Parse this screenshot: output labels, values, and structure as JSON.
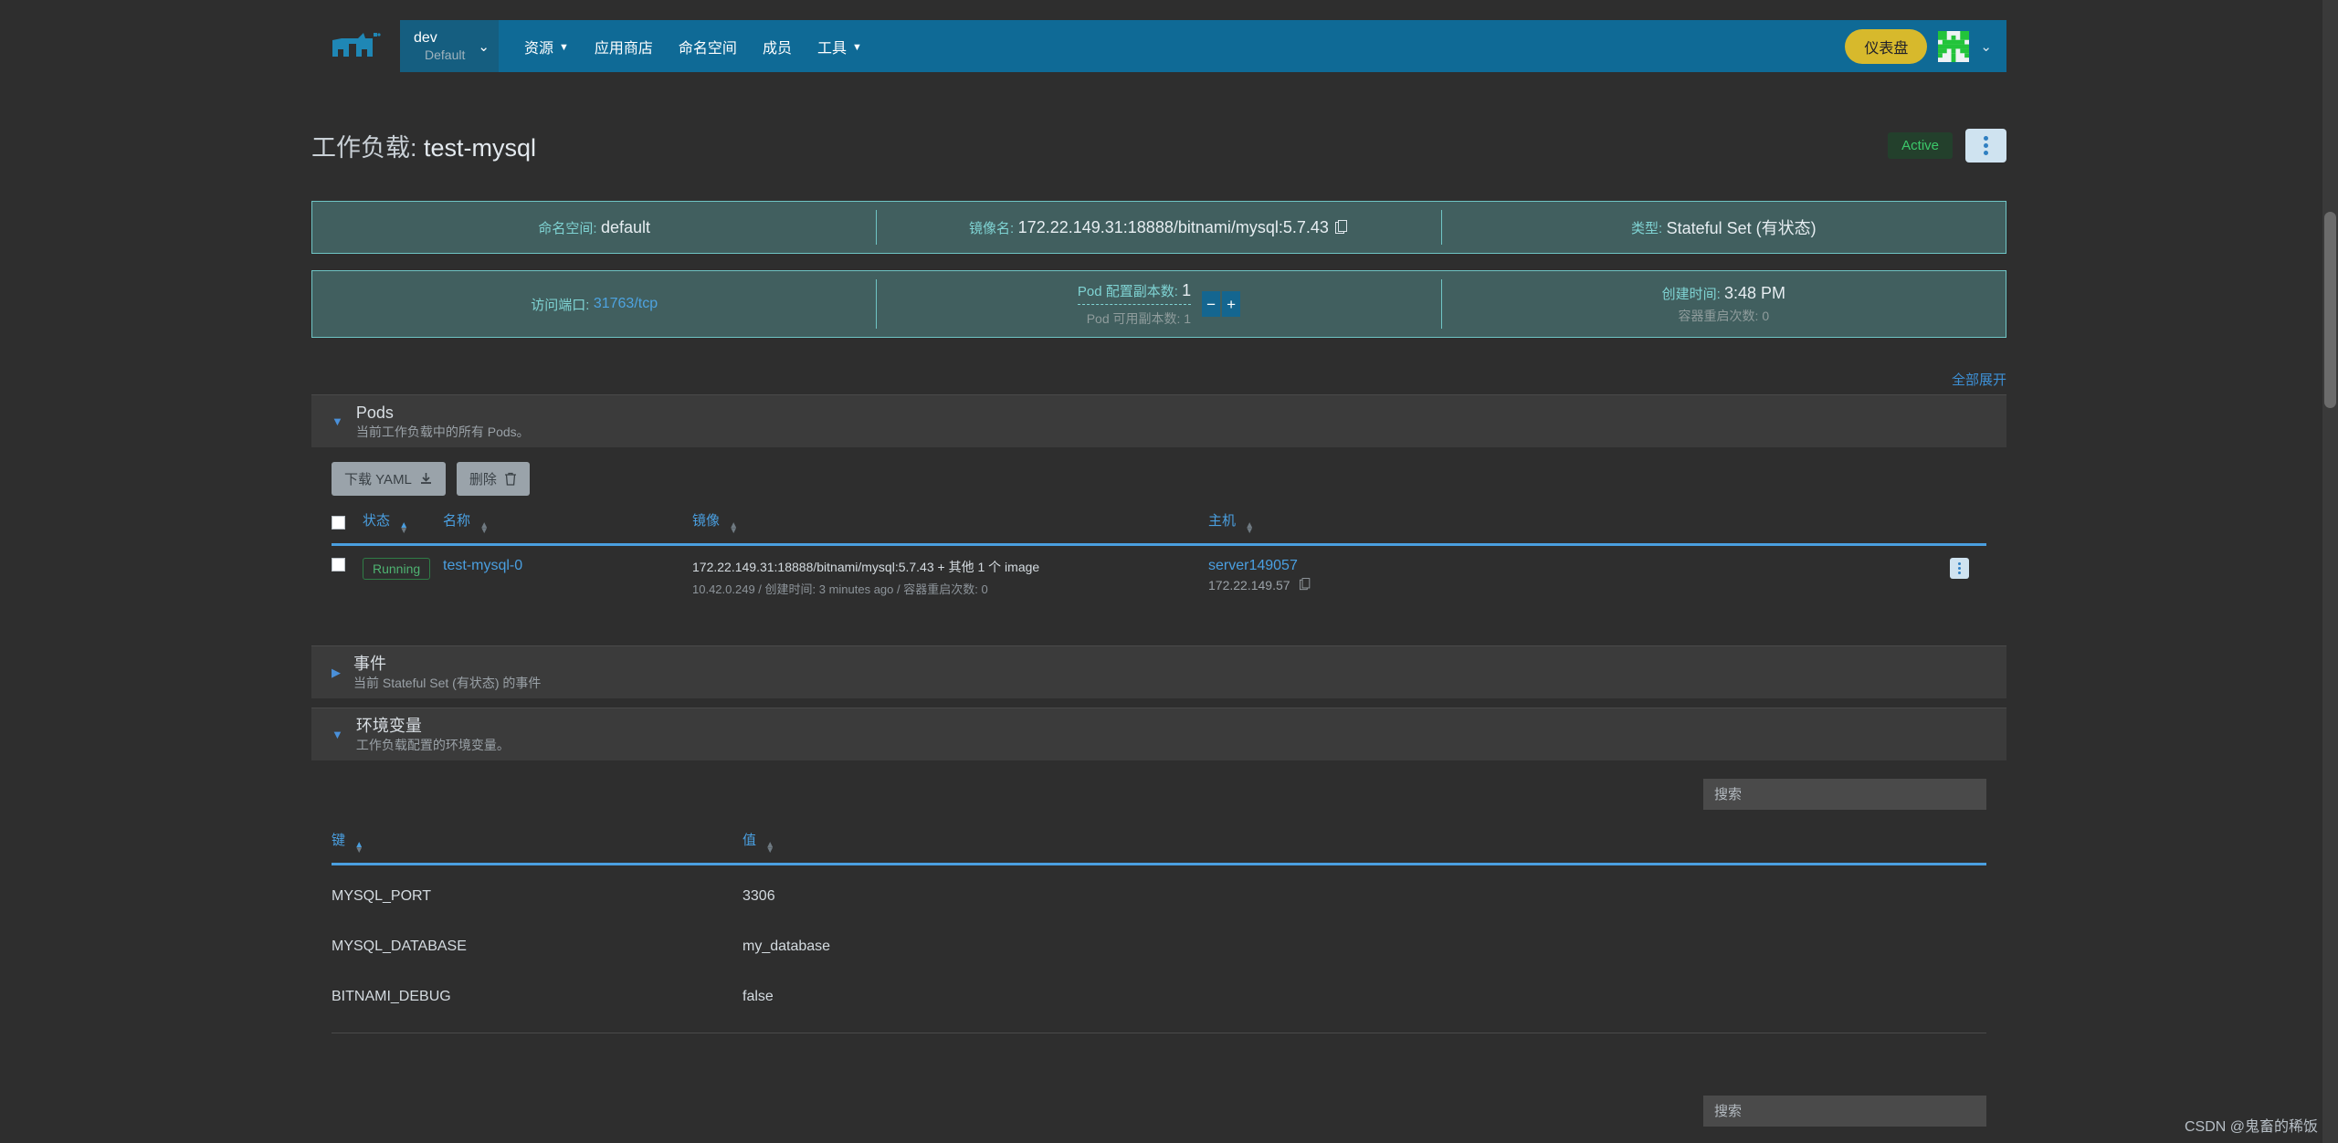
{
  "header": {
    "logo_icon": "cow-logo-icon",
    "cluster": {
      "name": "dev",
      "sub": "Default",
      "caret_icon": "chevron-down-icon"
    },
    "nav": [
      {
        "label": "资源",
        "has_caret": true
      },
      {
        "label": "应用商店",
        "has_caret": false
      },
      {
        "label": "命名空间",
        "has_caret": false
      },
      {
        "label": "成员",
        "has_caret": false
      },
      {
        "label": "工具",
        "has_caret": true
      }
    ],
    "dashboard_button": "仪表盘",
    "avatar_icon": "user-avatar-identicon",
    "avatar_caret_icon": "chevron-down-icon"
  },
  "title": {
    "label": "工作负载:",
    "name": "test-mysql",
    "status_badge": "Active",
    "kebab_icon": "more-vertical-icon"
  },
  "banner1": [
    {
      "label": "命名空间:",
      "value": "default"
    },
    {
      "label": "镜像名:",
      "value": "172.22.149.31:18888/bitnami/mysql:5.7.43",
      "copy_icon": "copy-icon"
    },
    {
      "label": "类型:",
      "value": "Stateful Set (有状态)"
    }
  ],
  "banner2": {
    "port": {
      "label": "访问端口:",
      "value": "31763/tcp"
    },
    "scale": {
      "configured_label": "Pod 配置副本数:",
      "configured_value": "1",
      "available_label": "Pod 可用副本数:",
      "available_value": "1",
      "minus_label": "−",
      "plus_label": "+"
    },
    "created": {
      "label": "创建时间:",
      "value": "3:48 PM",
      "restart_label": "容器重启次数:",
      "restart_value": "0"
    }
  },
  "expand_all": "全部展开",
  "sections": {
    "pods": {
      "title": "Pods",
      "sub": "当前工作负载中的所有 Pods。",
      "expanded": true,
      "tri_icon": "triangle-down-icon"
    },
    "events": {
      "title": "事件",
      "sub": "当前 Stateful Set (有状态) 的事件",
      "expanded": false,
      "tri_icon": "triangle-right-icon"
    },
    "env": {
      "title": "环境变量",
      "sub": "工作负载配置的环境变量。",
      "expanded": true,
      "tri_icon": "triangle-down-icon"
    }
  },
  "pods_toolbar": [
    {
      "label": "下载 YAML",
      "icon": "download-icon"
    },
    {
      "label": "删除",
      "icon": "trash-icon"
    }
  ],
  "pods_table": {
    "columns": [
      "状态",
      "名称",
      "镜像",
      "主机"
    ],
    "rows": [
      {
        "state": "Running",
        "name": "test-mysql-0",
        "image_main": "172.22.149.31:18888/bitnami/mysql:5.7.43 + 其他 1 个 image",
        "image_sub": "10.42.0.249 / 创建时间: 3 minutes ago / 容器重启次数: 0",
        "host_main": "server149057",
        "host_sub": "172.22.149.57",
        "host_copy_icon": "copy-icon",
        "kebab_icon": "more-vertical-icon"
      }
    ]
  },
  "env_table": {
    "search_placeholder": "搜索",
    "columns": [
      "键",
      "值"
    ],
    "rows": [
      {
        "key": "MYSQL_PORT",
        "value": "3306"
      },
      {
        "key": "MYSQL_DATABASE",
        "value": "my_database"
      },
      {
        "key": "BITNAMI_DEBUG",
        "value": "false"
      }
    ]
  },
  "env_table2": {
    "search_placeholder": "搜索"
  },
  "watermark": "CSDN @鬼畜的稀饭",
  "colors": {
    "nav_blue": "#0f6a96",
    "accent_blue": "#4a9fe0",
    "dashboard_yellow": "#d7b92c",
    "banner_bg": "#415f5f",
    "banner_border": "#6fc5c5",
    "running_green": "#4fb372",
    "page_bg": "#2e2e2e"
  }
}
